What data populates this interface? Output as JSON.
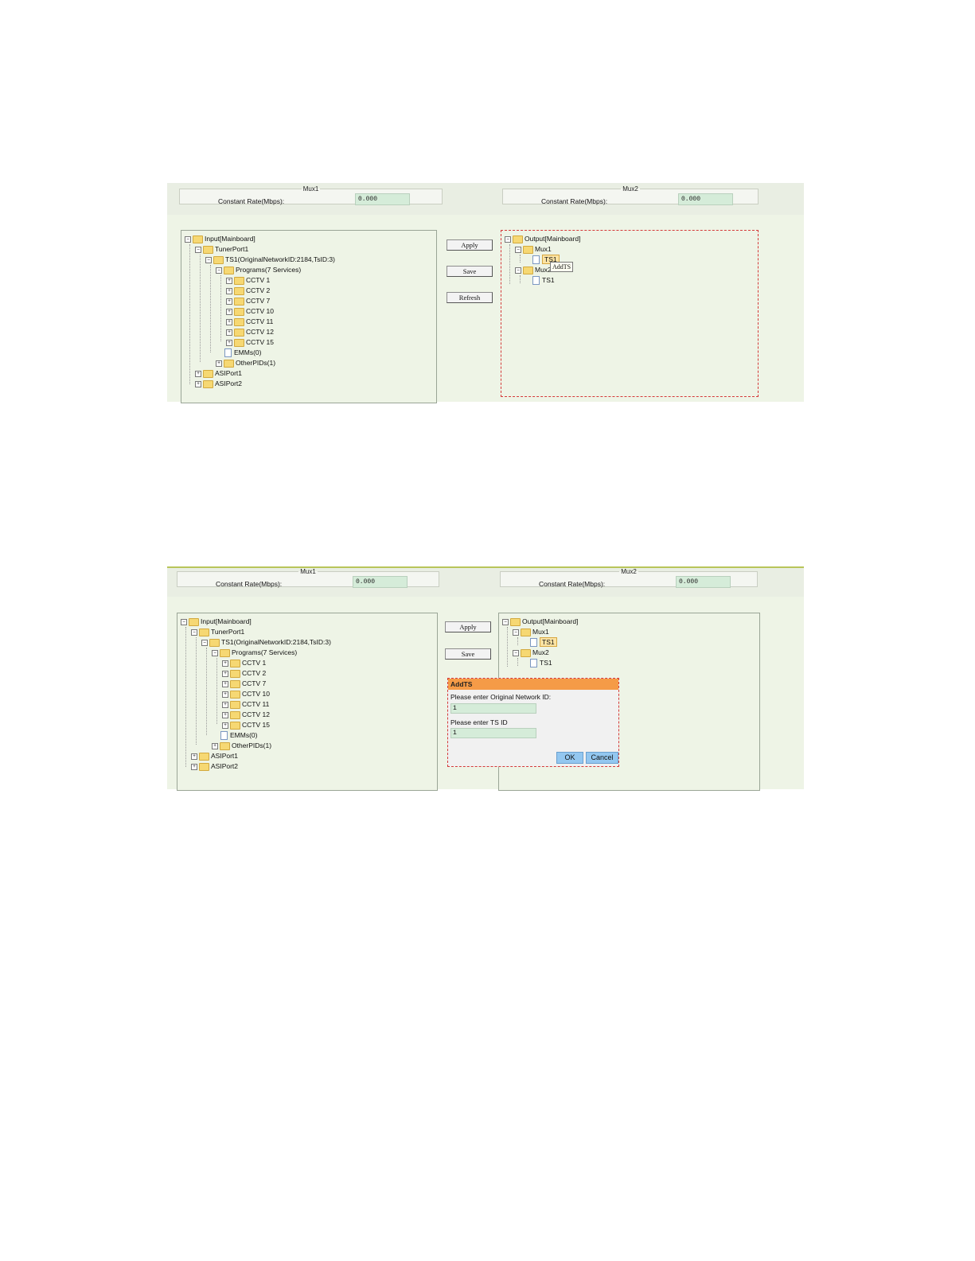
{
  "screens": {
    "s1": {
      "mux1_legend": "Mux1",
      "mux2_legend": "Mux2",
      "rate_label_1": "Constant Rate(Mbps):",
      "rate_value_1": "0.000",
      "rate_label_2": "Constant Rate(Mbps):",
      "rate_value_2": "0.000",
      "apply": "Apply",
      "save": "Save",
      "refresh": "Refresh",
      "tooltip": "AddTS"
    },
    "s2": {
      "mux1_legend": "Mux1",
      "mux2_legend": "Mux2",
      "rate_label_1": "Constant Rate(Mbps):",
      "rate_value_1": "0.000",
      "rate_label_2": "Constant Rate(Mbps):",
      "rate_value_2": "0.000",
      "apply": "Apply",
      "save": "Save",
      "dialog": {
        "title": "AddTS",
        "q1": "Please enter Original Network ID:",
        "v1": "1",
        "q2": "Please enter TS ID",
        "v2": "1",
        "ok": "OK",
        "cancel": "Cancel"
      }
    }
  },
  "input_tree": {
    "root": "Input[Mainboard]",
    "tuner": "TunerPort1",
    "ts": "TS1(OriginalNetworkID:2184,TsID:3)",
    "programs": "Programs(7 Services)",
    "services": [
      "CCTV 1",
      "CCTV 2",
      "CCTV 7",
      "CCTV 10",
      "CCTV 11",
      "CCTV 12",
      "CCTV 15"
    ],
    "emms": "EMMs(0)",
    "other": "OtherPIDs(1)",
    "asi1": "ASIPort1",
    "asi2": "ASIPort2"
  },
  "output_tree": {
    "root": "Output[Mainboard]",
    "mux1": "Mux1",
    "mux1_ts": "TS1",
    "mux2": "Mux2",
    "mux2_ts": "TS1"
  }
}
